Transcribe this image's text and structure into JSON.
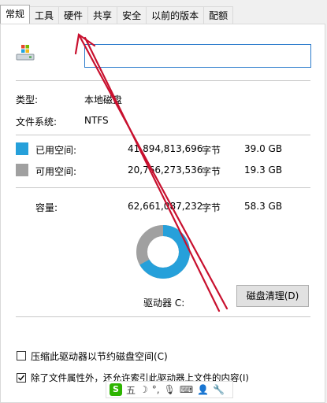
{
  "tabs": [
    "常规",
    "工具",
    "硬件",
    "共享",
    "安全",
    "以前的版本",
    "配额"
  ],
  "name_field": {
    "value": ""
  },
  "type": {
    "label": "类型:",
    "value": "本地磁盘"
  },
  "filesystem": {
    "label": "文件系统:",
    "value": "NTFS"
  },
  "used": {
    "label": "已用空间:",
    "bytes": "41,894,813,696",
    "unit": "字节",
    "size": "39.0 GB",
    "color": "#26a0da"
  },
  "free": {
    "label": "可用空间:",
    "bytes": "20,766,273,536",
    "unit": "字节",
    "size": "19.3 GB",
    "color": "#a0a0a0"
  },
  "capacity": {
    "label": "容量:",
    "bytes": "62,661,087,232",
    "unit": "字节",
    "size": "58.3 GB"
  },
  "usage_fraction": 0.668,
  "drive_label": "驱动器 C:",
  "cleanup_button": "磁盘清理(D)",
  "compress_option": {
    "label": "压缩此驱动器以节约磁盘空间(C)",
    "checked": false
  },
  "index_option": {
    "label": "除了文件属性外，还允许索引此驱动器上文件的内容(I)",
    "checked": true
  },
  "ime_toolbar": {
    "logo": "S",
    "mode": "五",
    "icons": [
      "moon-icon",
      "punctuation-icon",
      "mic-icon",
      "keyboard-icon",
      "user-icon",
      "wrench-icon"
    ]
  },
  "annotation_color": "#c8102e"
}
